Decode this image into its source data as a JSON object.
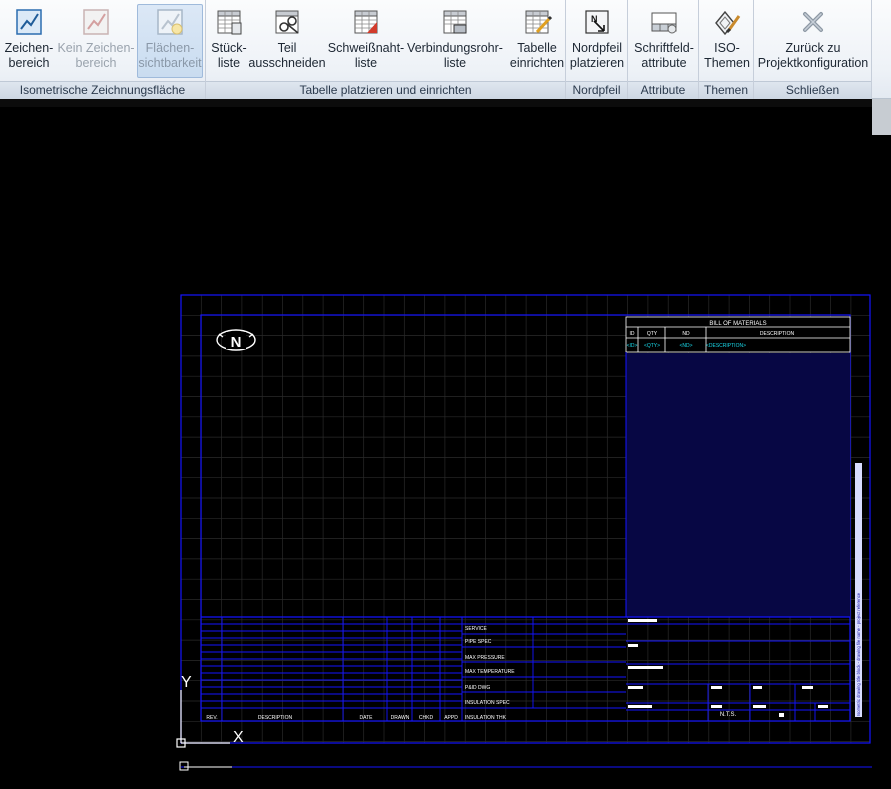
{
  "ribbon": {
    "panels": {
      "iso": "Isometrische Zeichnungsfläche",
      "table": "Tabelle platzieren und einrichten",
      "north": "Nordpfeil",
      "attr": "Attribute",
      "themes": "Themen",
      "close": "Schließen"
    },
    "buttons": {
      "draw_area": [
        "Zeichen-",
        "bereich"
      ],
      "no_draw_area": [
        "Kein Zeichen-",
        "bereich"
      ],
      "area_visibility": [
        "Flächen-",
        "sichtbarkeit"
      ],
      "parts_list": [
        "Stück-",
        "liste"
      ],
      "cut_part": [
        "Teil",
        "ausschneiden"
      ],
      "weld_list": [
        "Schweißnaht-",
        "liste"
      ],
      "connection_list": [
        "Verbindungsrohr-",
        "liste"
      ],
      "setup_table": [
        "Tabelle",
        "einrichten"
      ],
      "place_north": [
        "Nordpfeil",
        "platzieren"
      ],
      "titleblock_attr": [
        "Schriftfeld-",
        "attribute"
      ],
      "iso_themes": [
        "ISO-",
        "Themen"
      ],
      "back_config": [
        "Zurück zu",
        "Projektkonfiguration"
      ]
    }
  },
  "drawing": {
    "north_letter": "N",
    "bom": {
      "title": "BILL OF MATERIALS",
      "headers": [
        "ID",
        "QTY",
        "ND",
        "DESCRIPTION"
      ],
      "placeholders": [
        "<ID>",
        "<QTY>",
        "<ND>",
        "<DESCRIPTION>"
      ]
    },
    "revision_headers": [
      "REV.",
      "DESCRIPTION",
      "DATE",
      "DRAWN",
      "CHKD",
      "APPD"
    ],
    "spec_labels": [
      "SERVICE",
      "PIPE SPEC",
      "MAX PRESSURE",
      "MAX TEMPERATURE",
      "P&ID DWG",
      "INSULATION SPEC",
      "INSULATION THK"
    ],
    "nts": "N.T.S.",
    "side_text": "Isometric drawing title block - drawing file name - project reference",
    "ucs": {
      "x": "X",
      "y": "Y"
    }
  }
}
